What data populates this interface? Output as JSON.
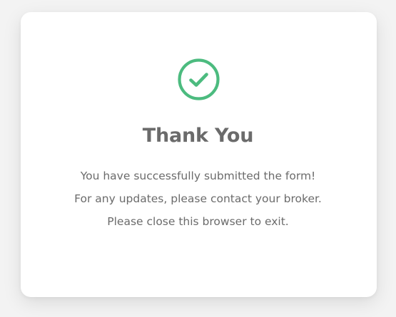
{
  "dialog": {
    "icon": "check-circle-icon",
    "accent_color": "#4cbb7f",
    "title": "Thank You",
    "messages": [
      "You have successfully submitted the form!",
      "For any updates, please contact your broker.",
      "Please close this browser to exit."
    ]
  }
}
